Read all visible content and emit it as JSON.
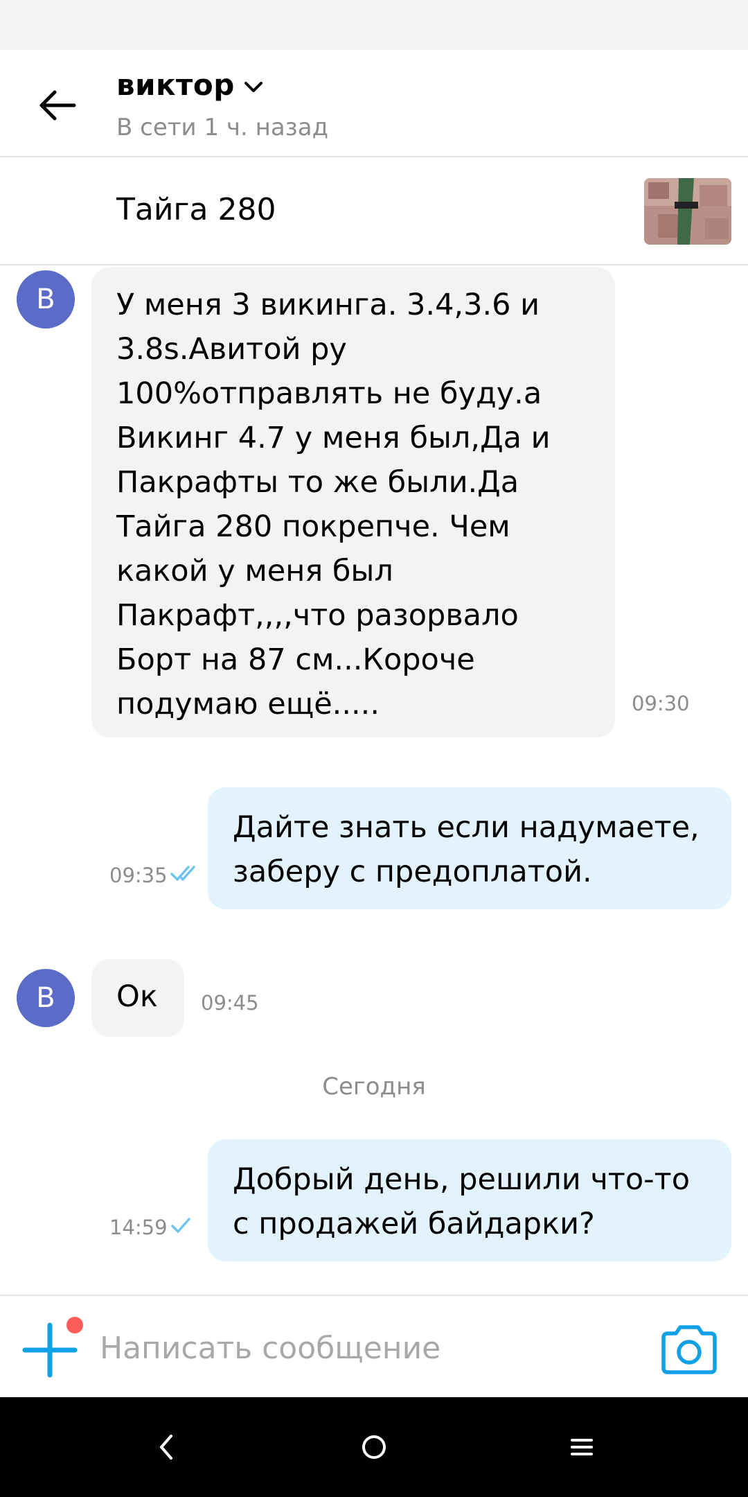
{
  "header": {
    "contact_name": "виктор",
    "last_seen": "В сети 1 ч. назад"
  },
  "listing": {
    "title": "Тайга 280"
  },
  "messages": [
    {
      "direction": "incoming",
      "avatar_letter": "В",
      "text": "У меня 3 викинга. 3.4,3.6 и 3.8s.Авитой ру 100%отправлять не буду.а Викинг 4.7 у меня был,Да и Пакрафты то же были.Да Тайга 280 покрепче. Чем какой у меня был Пакрафт,,,,что разорвало Борт на 87 см...Короче подумаю ещё.....",
      "time": "09:30"
    },
    {
      "direction": "outgoing",
      "text": "Дайте знать если надумаете, заберу с предоплатой.",
      "time": "09:35",
      "status": "read"
    },
    {
      "direction": "incoming",
      "avatar_letter": "В",
      "text": "Ок",
      "time": "09:45"
    },
    {
      "direction": "outgoing",
      "text": "Добрый день, решили что-то с продажей байдарки?",
      "time": "14:59",
      "status": "delivered"
    }
  ],
  "day_separator": "Сегодня",
  "composer": {
    "placeholder": "Написать сообщение"
  },
  "colors": {
    "accent": "#0fa0e6",
    "avatar_bg": "#5c6bc8",
    "incoming_bubble": "#f3f3f3",
    "outgoing_bubble": "#e2f3fd",
    "notification_dot": "#ff5a5a"
  }
}
